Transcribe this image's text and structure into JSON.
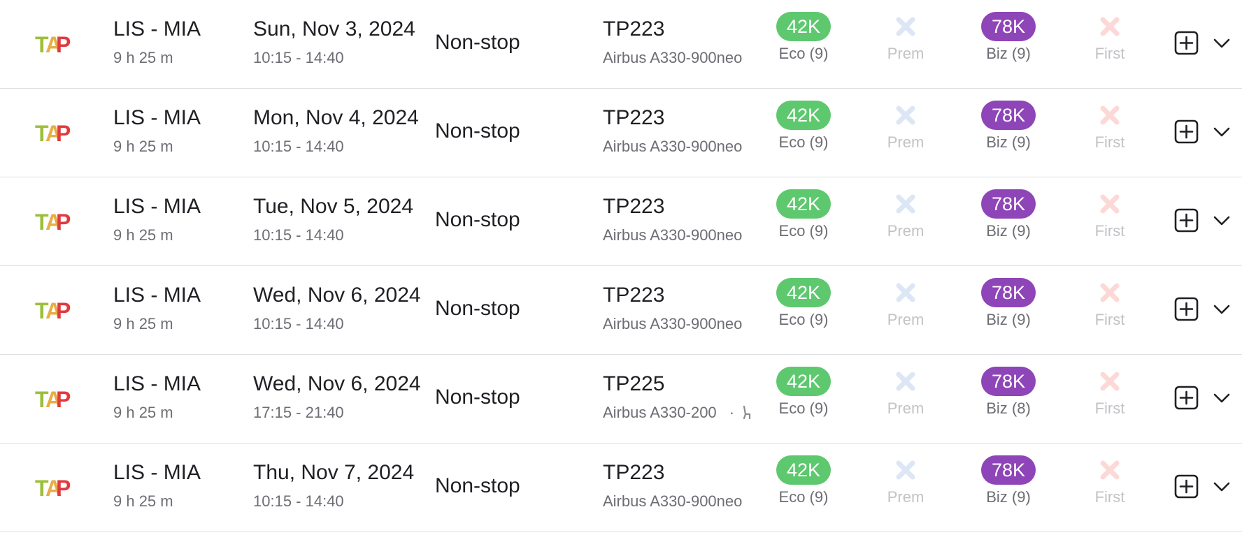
{
  "colors": {
    "economy_pill": "#5ec86f",
    "business_pill": "#8e45b8",
    "premium_unavailable": "#dde6f5",
    "first_unavailable": "#fcd9d7",
    "divider": "#dedee3"
  },
  "icons": {
    "airline_logo": "tap-logo",
    "add": "plus-square-icon",
    "expand": "chevron-down-icon",
    "unavailable": "x-icon"
  },
  "flights": [
    {
      "route": "LIS - MIA",
      "duration": "9 h 25 m",
      "date": "Sun, Nov 3, 2024",
      "times": "10:15 - 14:40",
      "stops": "Non-stop",
      "flight_number": "TP223",
      "aircraft": "Airbus A330-900neo",
      "eco": {
        "price": "42K",
        "label": "Eco (9)"
      },
      "prem": {
        "label": "Prem"
      },
      "biz": {
        "price": "78K",
        "label": "Biz (9)"
      },
      "first": {
        "label": "First"
      }
    },
    {
      "route": "LIS - MIA",
      "duration": "9 h 25 m",
      "date": "Mon, Nov 4, 2024",
      "times": "10:15 - 14:40",
      "stops": "Non-stop",
      "flight_number": "TP223",
      "aircraft": "Airbus A330-900neo",
      "eco": {
        "price": "42K",
        "label": "Eco (9)"
      },
      "prem": {
        "label": "Prem"
      },
      "biz": {
        "price": "78K",
        "label": "Biz (9)"
      },
      "first": {
        "label": "First"
      }
    },
    {
      "route": "LIS - MIA",
      "duration": "9 h 25 m",
      "date": "Tue, Nov 5, 2024",
      "times": "10:15 - 14:40",
      "stops": "Non-stop",
      "flight_number": "TP223",
      "aircraft": "Airbus A330-900neo",
      "eco": {
        "price": "42K",
        "label": "Eco (9)"
      },
      "prem": {
        "label": "Prem"
      },
      "biz": {
        "price": "78K",
        "label": "Biz (9)"
      },
      "first": {
        "label": "First"
      }
    },
    {
      "route": "LIS - MIA",
      "duration": "9 h 25 m",
      "date": "Wed, Nov 6, 2024",
      "times": "10:15 - 14:40",
      "stops": "Non-stop",
      "flight_number": "TP223",
      "aircraft": "Airbus A330-900neo",
      "eco": {
        "price": "42K",
        "label": "Eco (9)"
      },
      "prem": {
        "label": "Prem"
      },
      "biz": {
        "price": "78K",
        "label": "Biz (9)"
      },
      "first": {
        "label": "First"
      }
    },
    {
      "route": "LIS - MIA",
      "duration": "9 h 25 m",
      "date": "Wed, Nov 6, 2024",
      "times": "17:15 - 21:40",
      "stops": "Non-stop",
      "flight_number": "TP225",
      "aircraft": "Airbus A330-200",
      "aircraft_extra": "·",
      "aircraft_icon": "seat-icon",
      "eco": {
        "price": "42K",
        "label": "Eco (9)"
      },
      "prem": {
        "label": "Prem"
      },
      "biz": {
        "price": "78K",
        "label": "Biz (8)"
      },
      "first": {
        "label": "First"
      }
    },
    {
      "route": "LIS - MIA",
      "duration": "9 h 25 m",
      "date": "Thu, Nov 7, 2024",
      "times": "10:15 - 14:40",
      "stops": "Non-stop",
      "flight_number": "TP223",
      "aircraft": "Airbus A330-900neo",
      "eco": {
        "price": "42K",
        "label": "Eco (9)"
      },
      "prem": {
        "label": "Prem"
      },
      "biz": {
        "price": "78K",
        "label": "Biz (9)"
      },
      "first": {
        "label": "First"
      }
    }
  ]
}
